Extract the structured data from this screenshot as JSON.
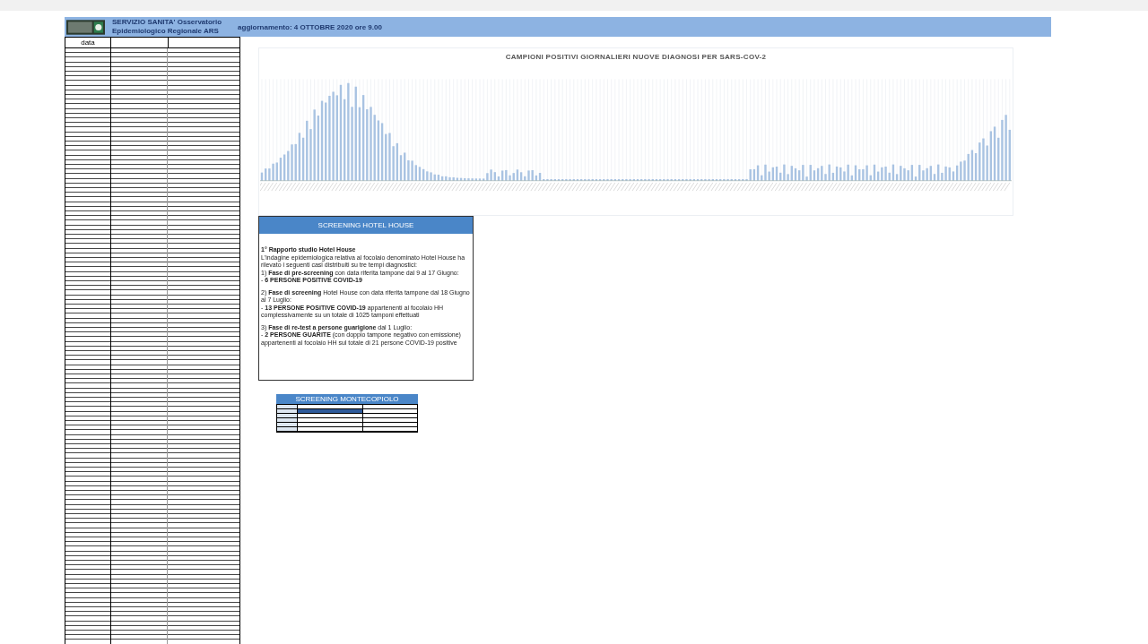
{
  "header": {
    "org_lines": [
      "SERVIZIO SANITA' Osservatorio",
      "Epidemiologico Regionale ARS"
    ],
    "update": "aggiornamento: 4 OTTOBRE 2020 ore 9.00"
  },
  "left_table": {
    "first_column_header": "data"
  },
  "chart": {
    "title": "CAMPIONI POSITIVI GIORNALIERI NUOVE DIAGNOSI PER SARS-COV-2"
  },
  "hotel_house": {
    "title": "SCREENING HOTEL HOUSE",
    "paragraphs": [
      {
        "kind": "heading",
        "text": "1° Rapporto studio Hotel House"
      },
      {
        "kind": "line",
        "text": "L'indagine epidemiologica relativa al focolaio denominato Hotel House ha rilevato i seguenti casi distribuiti su tre tempi diagnostici:"
      },
      {
        "kind": "line",
        "text": "1) **Fase di pre-screening** con data riferita tampone dal 9 al 17 Giugno:"
      },
      {
        "kind": "line",
        "text": "- **6 PERSONE POSITIVE COVID-19**"
      },
      {
        "kind": "gap",
        "text": "2) **Fase di screening** Hotel House con data riferita tampone dal 18 Giugno al 7 Luglio:"
      },
      {
        "kind": "line",
        "text": "- **13 PERSONE POSITIVE COVID-19** appartenenti al focolaio HH complessivamente su un totale di 1025 tamponi effettuati"
      },
      {
        "kind": "gap",
        "text": "3) **Fase di re-test a persone guarigione** dal 1 Luglio:"
      },
      {
        "kind": "line",
        "text": "- **2 PERSONE GUARITE** (con doppio tampone negativo con emissione) appartenenti al focolaio HH sul totale di 21 persone COVID-19 positive"
      }
    ]
  },
  "montecopiolo": {
    "title": "SCREENING MONTECOPIOLO"
  }
}
